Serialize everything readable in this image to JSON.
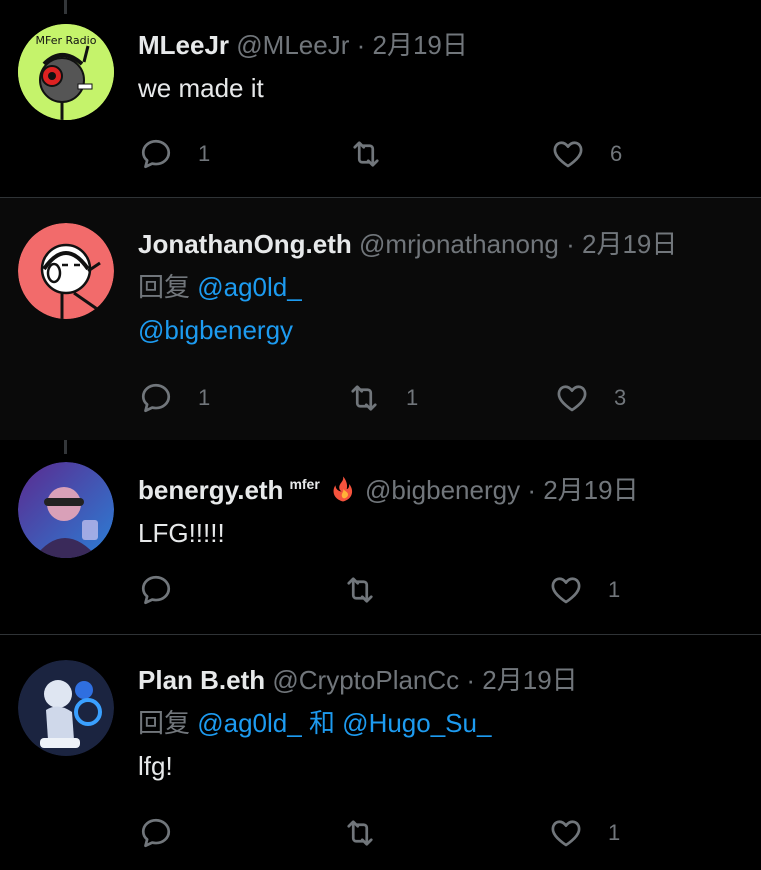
{
  "tweets": [
    {
      "name": "MLeeJr",
      "handle": "@MLeeJr",
      "sep": " · ",
      "time": "2月19日",
      "lines": [
        "we made it"
      ],
      "reply_count": "1",
      "retweet_count": "",
      "like_count": "6"
    },
    {
      "name": "JonathanOng.eth",
      "handle": "@mrjonathanong",
      "sep": " · ",
      "time": "2月19日",
      "reply_prefix": "回复 ",
      "reply_to": "@ag0ld_",
      "mention_line": "@bigbenergy",
      "reply_count": "1",
      "retweet_count": "1",
      "like_count": "3"
    },
    {
      "name": "benergy.eth",
      "badge": "mfer",
      "handle": "@bigbenergy",
      "sep": " · ",
      "time": "2月19日",
      "lines": [
        "LFG!!!!!"
      ],
      "reply_count": "",
      "retweet_count": "",
      "like_count": "1"
    },
    {
      "name": "Plan B.eth",
      "handle": "@CryptoPlanCc",
      "sep": " · ",
      "time": "2月19日",
      "reply_prefix": "回复 ",
      "reply_to": "@ag0ld_",
      "conj": " 和 ",
      "reply_to2": "@Hugo_Su_",
      "lines": [
        "lfg!"
      ],
      "reply_count": "",
      "retweet_count": "",
      "like_count": "1"
    }
  ],
  "avatars": {
    "t0_label": "MFer Radio"
  },
  "colors": {
    "background": "#000000",
    "highlight_bg": "#0a0a0a",
    "text": "#e7e9ea",
    "muted": "#71767b",
    "link": "#1d9bf0",
    "divider": "#2f3336"
  },
  "icons": [
    "reply-icon",
    "retweet-icon",
    "like-icon",
    "fire-icon"
  ]
}
